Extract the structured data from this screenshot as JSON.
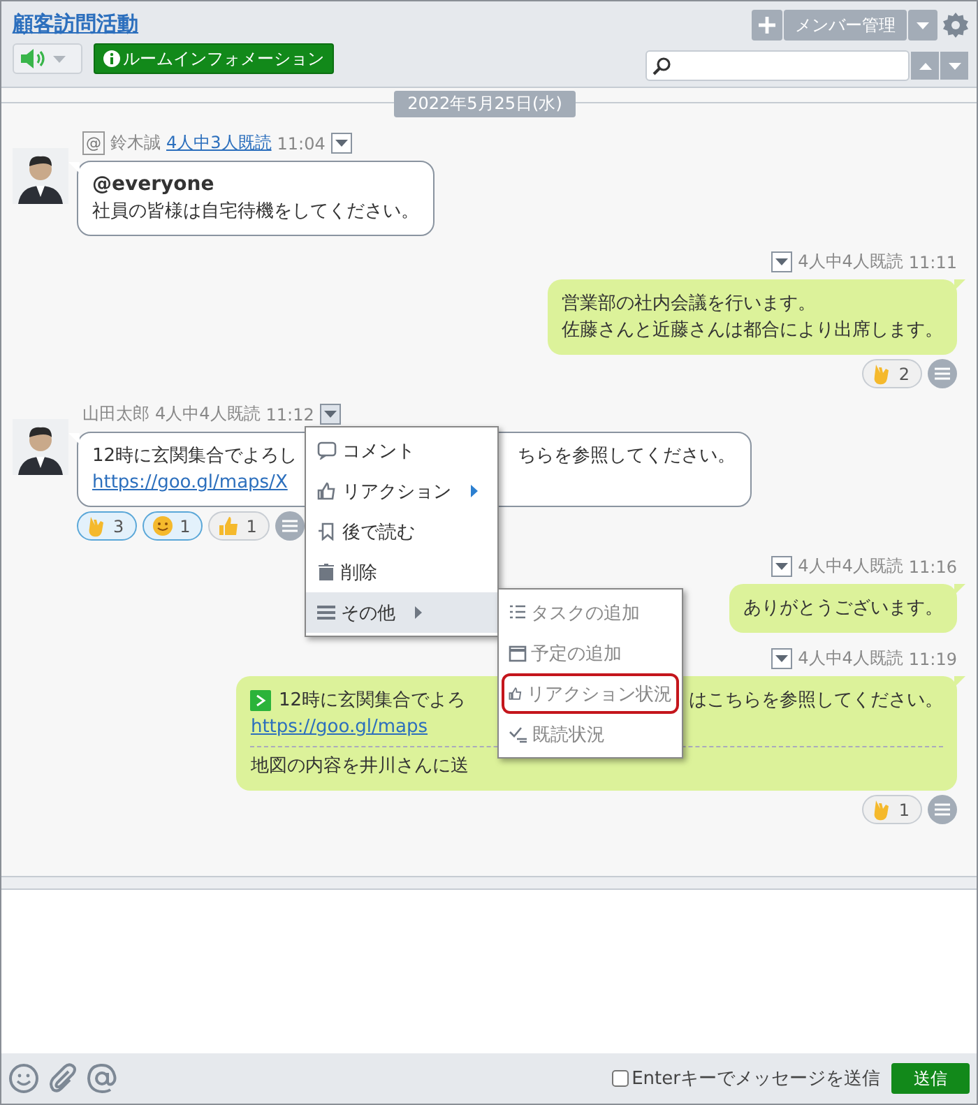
{
  "header": {
    "title": "顧客訪問活動",
    "room_info": "ルームインフォメーション",
    "member_button": "メンバー管理",
    "sound_on": true
  },
  "date": "2022年5月25日(水)",
  "messages": [
    {
      "kind": "incoming",
      "sender": "鈴木誠",
      "mention": "@",
      "read_status": "4人中3人既読",
      "read_link": true,
      "time": "11:04",
      "lines": [
        {
          "kind": "bold",
          "parts": [
            "@everyone"
          ]
        },
        {
          "kind": "text",
          "parts": [
            "社員の皆様は自宅待機をしてください。"
          ]
        }
      ]
    },
    {
      "kind": "outgoing",
      "read_status": "4人中4人既読",
      "read_link": false,
      "time": "11:11",
      "lines": [
        {
          "kind": "text",
          "parts": [
            "営業部の社内会議を行います。"
          ]
        },
        {
          "kind": "text",
          "parts": [
            "佐藤さんと近藤さんは都合により出席します。"
          ]
        }
      ],
      "reactions": [
        {
          "kind": "ok",
          "count": "2",
          "selected": false
        }
      ]
    },
    {
      "kind": "incoming",
      "sender": "山田太郎",
      "read_status": "4人中4人既読",
      "read_link": false,
      "time": "11:12",
      "lines": [
        {
          "kind": "text",
          "parts": [
            "12時に玄関集合でよろし",
            "ちらを参照してください。"
          ]
        },
        {
          "kind": "link",
          "parts": [
            "https://goo.gl/maps/X"
          ]
        }
      ],
      "reactions": [
        {
          "kind": "ok",
          "count": "3",
          "selected": true
        },
        {
          "kind": "smile",
          "count": "1",
          "selected": true
        },
        {
          "kind": "thumb",
          "count": "1",
          "selected": false
        }
      ],
      "menu_open": true
    },
    {
      "kind": "outgoing",
      "read_status": "4人中4人既読",
      "read_link": false,
      "time": "11:16",
      "lines": [
        {
          "kind": "text",
          "parts": [
            "ありがとうございます。"
          ]
        }
      ]
    },
    {
      "kind": "outgoing",
      "quote": true,
      "read_status": "4人中4人既読",
      "read_link": false,
      "time": "11:19",
      "lines": [
        {
          "kind": "text",
          "parts": [
            "12時に玄関集合でよろ",
            "はこちらを参照してください。"
          ]
        },
        {
          "kind": "link",
          "parts": [
            "https://goo.gl/maps"
          ]
        },
        {
          "kind": "divider"
        },
        {
          "kind": "text",
          "parts": [
            "地図の内容を井川さんに送"
          ]
        }
      ],
      "reactions": [
        {
          "kind": "ok",
          "count": "1",
          "selected": false
        }
      ]
    }
  ],
  "menu": {
    "items": [
      {
        "kind": "comment",
        "label": "コメント",
        "submenu": false,
        "selected": false
      },
      {
        "kind": "reaction",
        "label": "リアクション",
        "submenu": true,
        "selected": false
      },
      {
        "kind": "later",
        "label": "後で読む",
        "submenu": false,
        "selected": false
      },
      {
        "kind": "delete",
        "label": "削除",
        "submenu": false,
        "selected": false
      },
      {
        "kind": "more",
        "label": "その他",
        "submenu": true,
        "selected": true
      }
    ],
    "submenu": [
      {
        "kind": "task",
        "label": "タスクの追加",
        "outlined": false
      },
      {
        "kind": "schedule",
        "label": "予定の追加",
        "outlined": false
      },
      {
        "kind": "reaction",
        "label": "リアクション状況",
        "outlined": true
      },
      {
        "kind": "read",
        "label": "既読状況",
        "outlined": false
      }
    ]
  },
  "footer": {
    "enter_label": "Enterキーでメッセージを送信",
    "enter_checked": false,
    "send": "送信"
  }
}
